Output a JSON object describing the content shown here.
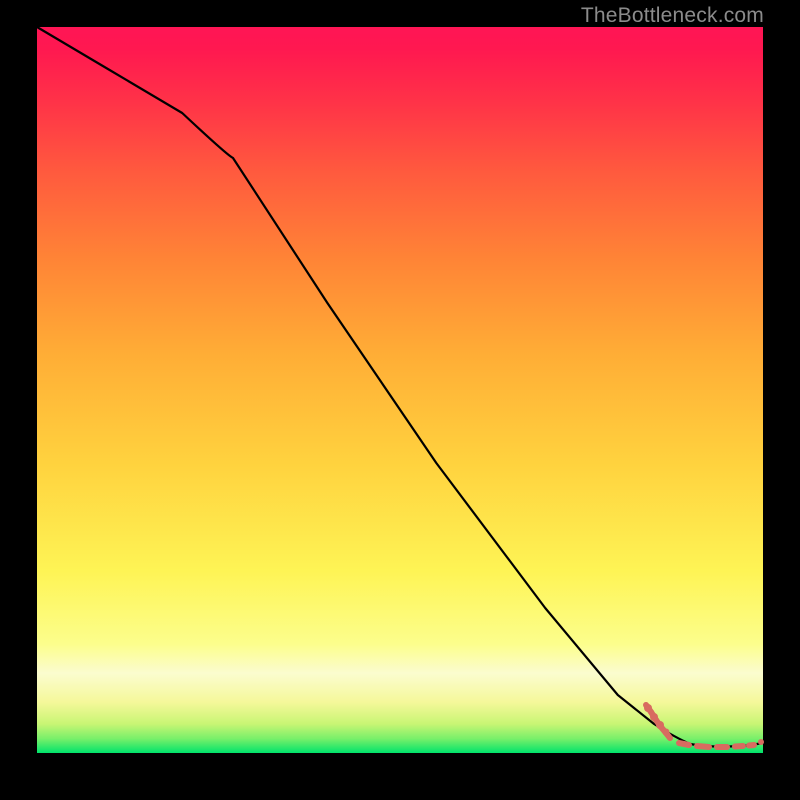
{
  "watermark": "TheBottleneck.com",
  "chart_data": {
    "type": "line",
    "title": "",
    "xlabel": "",
    "ylabel": "",
    "xlim": [
      0,
      100
    ],
    "ylim": [
      0,
      100
    ],
    "grid": false,
    "legend": false,
    "series": [
      {
        "name": "bottleneck-curve",
        "color": "#000000",
        "x": [
          0,
          10,
          20,
          27,
          40,
          55,
          70,
          80,
          85,
          88,
          90,
          92,
          95,
          98,
          100
        ],
        "y": [
          100,
          94,
          88,
          82,
          62,
          40,
          20,
          8,
          4,
          2,
          1.2,
          1.0,
          0.9,
          1.0,
          1.4
        ]
      },
      {
        "name": "selected-points-dashline",
        "color": "#d96a5f",
        "style": "dashed",
        "x": [
          85,
          88,
          90,
          92,
          95,
          98,
          100
        ],
        "y": [
          4,
          2,
          1.2,
          1.0,
          0.9,
          1.0,
          1.4
        ]
      }
    ],
    "markers": [
      {
        "x": 84.5,
        "y": 4.8,
        "r": 1.2,
        "color": "#d96a5f"
      },
      {
        "x": 85.4,
        "y": 3.6,
        "r": 1.2,
        "color": "#d96a5f"
      },
      {
        "x": 86.2,
        "y": 2.6,
        "r": 1.2,
        "color": "#d96a5f"
      },
      {
        "x": 87.0,
        "y": 2.0,
        "r": 1.0,
        "color": "#d96a5f"
      },
      {
        "x": 99.5,
        "y": 1.6,
        "r": 0.8,
        "color": "#d96a5f"
      }
    ]
  }
}
